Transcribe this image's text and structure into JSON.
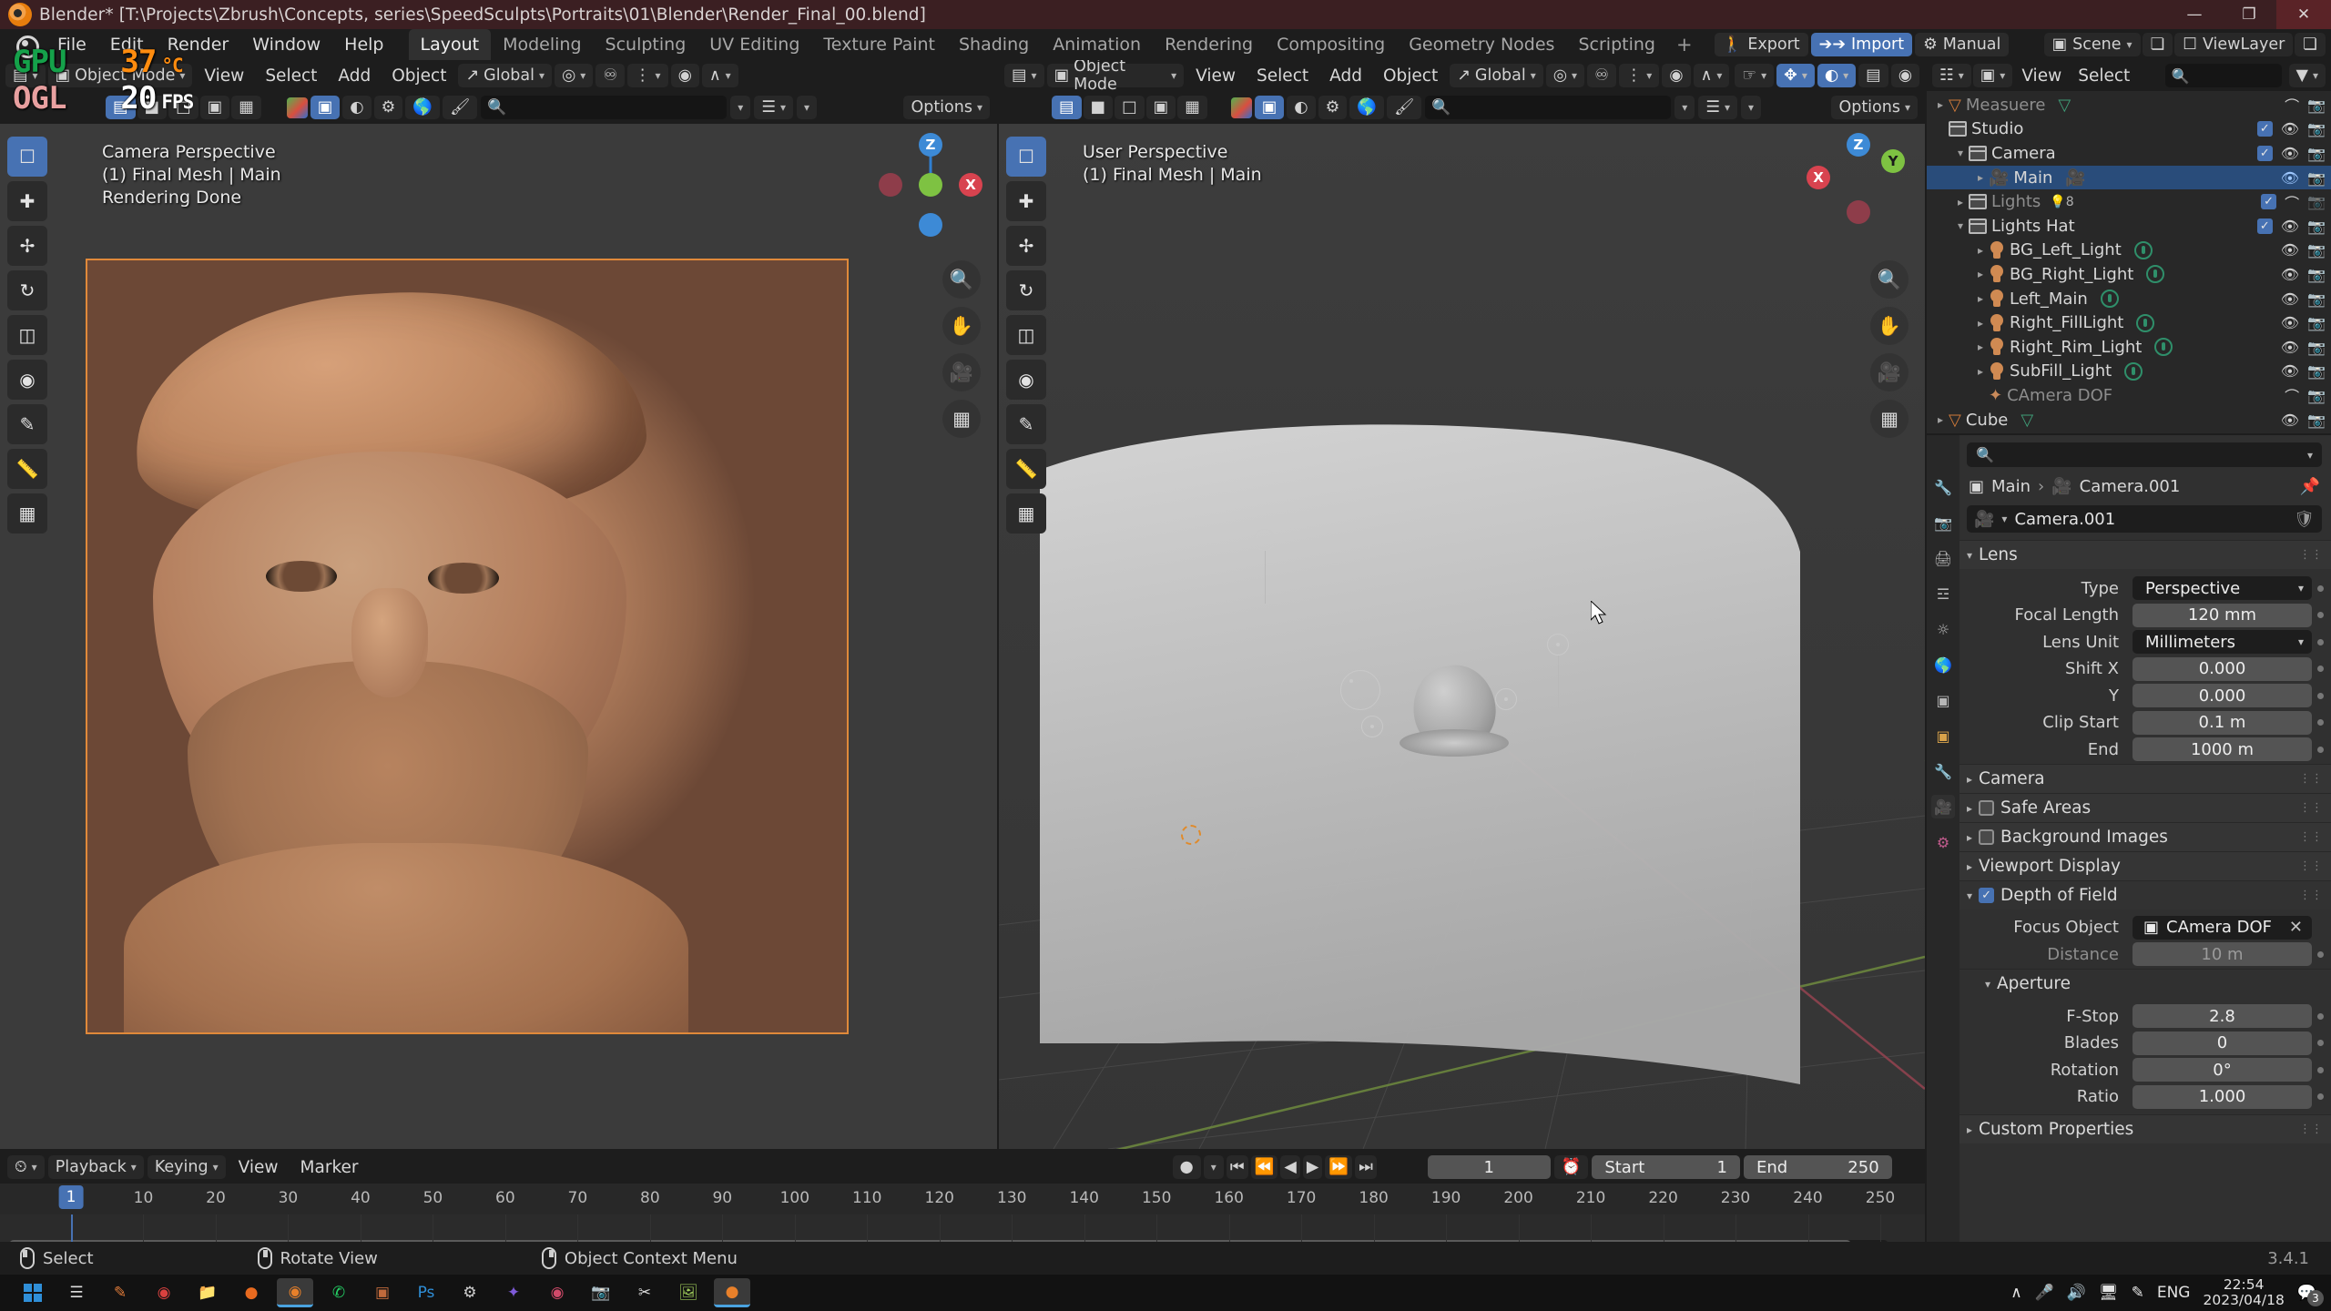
{
  "window": {
    "title": "Blender* [T:\\Projects\\Zbrush\\Concepts, series\\SpeedSculpts\\Portraits\\01\\Blender\\Render_Final_00.blend]",
    "minimize": "—",
    "maximize": "❐",
    "close": "✕"
  },
  "topbar": {
    "menus": [
      "File",
      "Edit",
      "Render",
      "Window",
      "Help"
    ],
    "workspaces": [
      "Layout",
      "Modeling",
      "Sculpting",
      "UV Editing",
      "Texture Paint",
      "Shading",
      "Animation",
      "Rendering",
      "Compositing",
      "Geometry Nodes",
      "Scripting"
    ],
    "active_workspace": "Layout",
    "add_workspace": "+",
    "export_label": "Export",
    "import_label": "Import",
    "manual_label": "Manual",
    "scene_label": "Scene",
    "viewlayer_label": "ViewLayer"
  },
  "overlay": {
    "gpu_label": "GPU",
    "gpu_value": "37",
    "gpu_unit": "°C",
    "ogl_label": "OGL",
    "fps_value": "20",
    "fps_unit": "FPS"
  },
  "viewport_left": {
    "mode": "Object Mode",
    "menus": [
      "View",
      "Select",
      "Add",
      "Object"
    ],
    "transform_orientation": "Global",
    "options_label": "Options",
    "view_name": "Camera Perspective",
    "collection_object": "(1) Final Mesh | Main",
    "status": "Rendering Done",
    "gizmo_axes": [
      "Z",
      "Y",
      "X"
    ]
  },
  "viewport_right": {
    "mode": "Object Mode",
    "menus": [
      "View",
      "Select",
      "Add",
      "Object"
    ],
    "transform_orientation": "Global",
    "options_label": "Options",
    "view_name": "User Perspective",
    "collection_object": "(1) Final Mesh | Main",
    "gizmo_axes": [
      "Z",
      "Y",
      "X"
    ]
  },
  "outliner": {
    "menus": [
      "View",
      "Select",
      "Add",
      "Object"
    ],
    "search_placeholder": "",
    "rows": [
      {
        "name": "Measuere",
        "indent": 0,
        "type": "object-mesh",
        "dim": true,
        "arrow": "▸",
        "checkbox": null,
        "eye": "closed",
        "camera": "on"
      },
      {
        "name": "Studio",
        "indent": 0,
        "type": "collection",
        "dim": false,
        "arrow": "",
        "checkbox": true,
        "eye": "open",
        "camera": "on"
      },
      {
        "name": "Camera",
        "indent": 1,
        "type": "collection",
        "dim": false,
        "arrow": "▾",
        "checkbox": true,
        "eye": "open",
        "camera": "on"
      },
      {
        "name": "Main",
        "indent": 2,
        "type": "camera-object",
        "dim": false,
        "arrow": "▸",
        "checkbox": null,
        "eye": "open",
        "camera": "on",
        "selected": true
      },
      {
        "name": "Lights",
        "indent": 1,
        "type": "collection",
        "dim": true,
        "arrow": "▸",
        "checkbox": true,
        "eye": "closed",
        "camera": "off",
        "badge": "8"
      },
      {
        "name": "Lights Hat",
        "indent": 1,
        "type": "collection",
        "dim": false,
        "arrow": "▾",
        "checkbox": true,
        "eye": "open",
        "camera": "on"
      },
      {
        "name": "BG_Left_Light",
        "indent": 2,
        "type": "light",
        "dim": false,
        "arrow": "▸",
        "checkbox": null,
        "eye": "open",
        "camera": "on"
      },
      {
        "name": "BG_Right_Light",
        "indent": 2,
        "type": "light",
        "dim": false,
        "arrow": "▸",
        "checkbox": null,
        "eye": "open",
        "camera": "on"
      },
      {
        "name": "Left_Main",
        "indent": 2,
        "type": "light",
        "dim": false,
        "arrow": "▸",
        "checkbox": null,
        "eye": "open",
        "camera": "on"
      },
      {
        "name": "Right_FillLight",
        "indent": 2,
        "type": "light",
        "dim": false,
        "arrow": "▸",
        "checkbox": null,
        "eye": "open",
        "camera": "on"
      },
      {
        "name": "Right_Rim_Light",
        "indent": 2,
        "type": "light",
        "dim": false,
        "arrow": "▸",
        "checkbox": null,
        "eye": "open",
        "camera": "on"
      },
      {
        "name": "SubFill_Light",
        "indent": 2,
        "type": "light",
        "dim": false,
        "arrow": "▸",
        "checkbox": null,
        "eye": "open",
        "camera": "on"
      },
      {
        "name": "CAmera DOF",
        "indent": 2,
        "type": "empty",
        "dim": true,
        "arrow": "",
        "checkbox": null,
        "eye": "closed",
        "camera": "on"
      },
      {
        "name": "Cube",
        "indent": 0,
        "type": "object-mesh",
        "dim": false,
        "arrow": "▸",
        "checkbox": null,
        "eye": "open",
        "camera": "on"
      }
    ]
  },
  "properties": {
    "search_placeholder": "",
    "breadcrumb": [
      "Main",
      "Camera.001"
    ],
    "datablock_name": "Camera.001",
    "panels": {
      "lens": {
        "title": "Lens",
        "fields": [
          {
            "label": "Type",
            "value": "Perspective",
            "kind": "dropdown"
          },
          {
            "label": "Focal Length",
            "value": "120 mm",
            "kind": "number"
          },
          {
            "label": "Lens Unit",
            "value": "Millimeters",
            "kind": "dropdown"
          },
          {
            "label": "Shift X",
            "value": "0.000",
            "kind": "number"
          },
          {
            "label": "Y",
            "value": "0.000",
            "kind": "number"
          },
          {
            "label": "Clip Start",
            "value": "0.1 m",
            "kind": "number"
          },
          {
            "label": "End",
            "value": "1000 m",
            "kind": "number"
          }
        ]
      },
      "collapsed": [
        {
          "title": "Camera",
          "checkbox": null
        },
        {
          "title": "Safe Areas",
          "checkbox": false
        },
        {
          "title": "Background Images",
          "checkbox": false
        },
        {
          "title": "Viewport Display",
          "checkbox": null
        }
      ],
      "depth_of_field": {
        "title": "Depth of Field",
        "enabled": true,
        "focus_object_label": "Focus Object",
        "focus_object_value": "CAmera DOF",
        "distance_label": "Distance",
        "distance_value": "10 m",
        "aperture_title": "Aperture",
        "aperture_fields": [
          {
            "label": "F-Stop",
            "value": "2.8"
          },
          {
            "label": "Blades",
            "value": "0"
          },
          {
            "label": "Rotation",
            "value": "0°"
          },
          {
            "label": "Ratio",
            "value": "1.000"
          }
        ]
      },
      "custom_properties": "Custom Properties"
    }
  },
  "timeline": {
    "menus": [
      "Playback",
      "Keying",
      "View",
      "Marker"
    ],
    "current_frame": "1",
    "start_label": "Start",
    "start_value": "1",
    "end_label": "End",
    "end_value": "250",
    "ticks": [
      "10",
      "20",
      "30",
      "40",
      "50",
      "60",
      "70",
      "80",
      "90",
      "100",
      "110",
      "120",
      "130",
      "140",
      "150",
      "160",
      "170",
      "180",
      "190",
      "200",
      "210",
      "220",
      "230",
      "240",
      "250"
    ],
    "playhead_frame": "1"
  },
  "statusbar": {
    "hints": [
      {
        "mouse": "left",
        "label": "Select"
      },
      {
        "mouse": "middle",
        "label": "Rotate View"
      },
      {
        "mouse": "right",
        "label": "Object Context Menu"
      }
    ],
    "version": "3.4.1"
  },
  "taskbar": {
    "start_icon": "windows-icon",
    "items": [
      "task-view",
      "zbrush",
      "browser-opera",
      "file-explorer",
      "firefox",
      "blender-active",
      "whatsapp",
      "discord",
      "photoshop",
      "settings",
      "flash",
      "media",
      "image-viewer",
      "scissors",
      "gallery",
      "krita",
      "blender2"
    ],
    "tray": {
      "chevron": "∧",
      "mic": "mic-icon",
      "volume": "volume-icon",
      "network": "network-icon",
      "pen": "pen-icon",
      "language": "ENG",
      "time": "22:54",
      "date": "2023/04/18",
      "notifications": "3"
    }
  },
  "colors": {
    "accent_blue": "#4772b3",
    "orange": "#e0893a",
    "window_red": "#3b1f22",
    "editor_bg": "#1d1d1d",
    "viewport_bg": "#393939"
  }
}
